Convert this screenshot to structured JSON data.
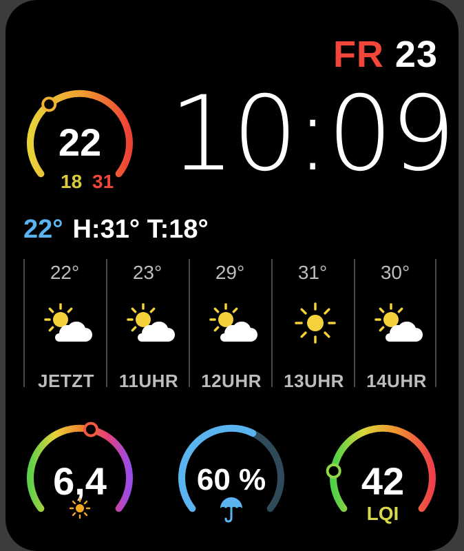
{
  "colors": {
    "accent": "#f2463b",
    "current_temp": "#5ab4f0",
    "rain_blue": "#5ab4f0",
    "sun_yellow": "#f5d23c",
    "cloud_white": "#ffffff",
    "low_temp": "#d8cc3e",
    "high_temp": "#f2463b",
    "aqi_label": "#d8d84a"
  },
  "date": {
    "weekday": "FR",
    "day": "23"
  },
  "time": "10:09",
  "temp_gauge": {
    "current": "22",
    "low": "18",
    "high": "31",
    "level": 0.35
  },
  "summary": {
    "current": "22°",
    "high_low": "H:31° T:18°"
  },
  "hourly": [
    {
      "label": "JETZT",
      "temp": "22°",
      "icon": "partly-cloudy-icon"
    },
    {
      "label": "11UHR",
      "temp": "23°",
      "icon": "partly-cloudy-icon"
    },
    {
      "label": "12UHR",
      "temp": "29°",
      "icon": "partly-cloudy-icon"
    },
    {
      "label": "13UHR",
      "temp": "31°",
      "icon": "sun-icon"
    },
    {
      "label": "14UHR",
      "temp": "30°",
      "icon": "partly-cloudy-icon"
    }
  ],
  "uv_gauge": {
    "value": "6,4",
    "level": 0.55,
    "icon": "sun-icon"
  },
  "rain_gauge": {
    "value": "60 %",
    "level": 0.6,
    "icon": "umbrella-icon"
  },
  "aqi_gauge": {
    "value": "42",
    "label": "LQI",
    "level": 0.18
  }
}
